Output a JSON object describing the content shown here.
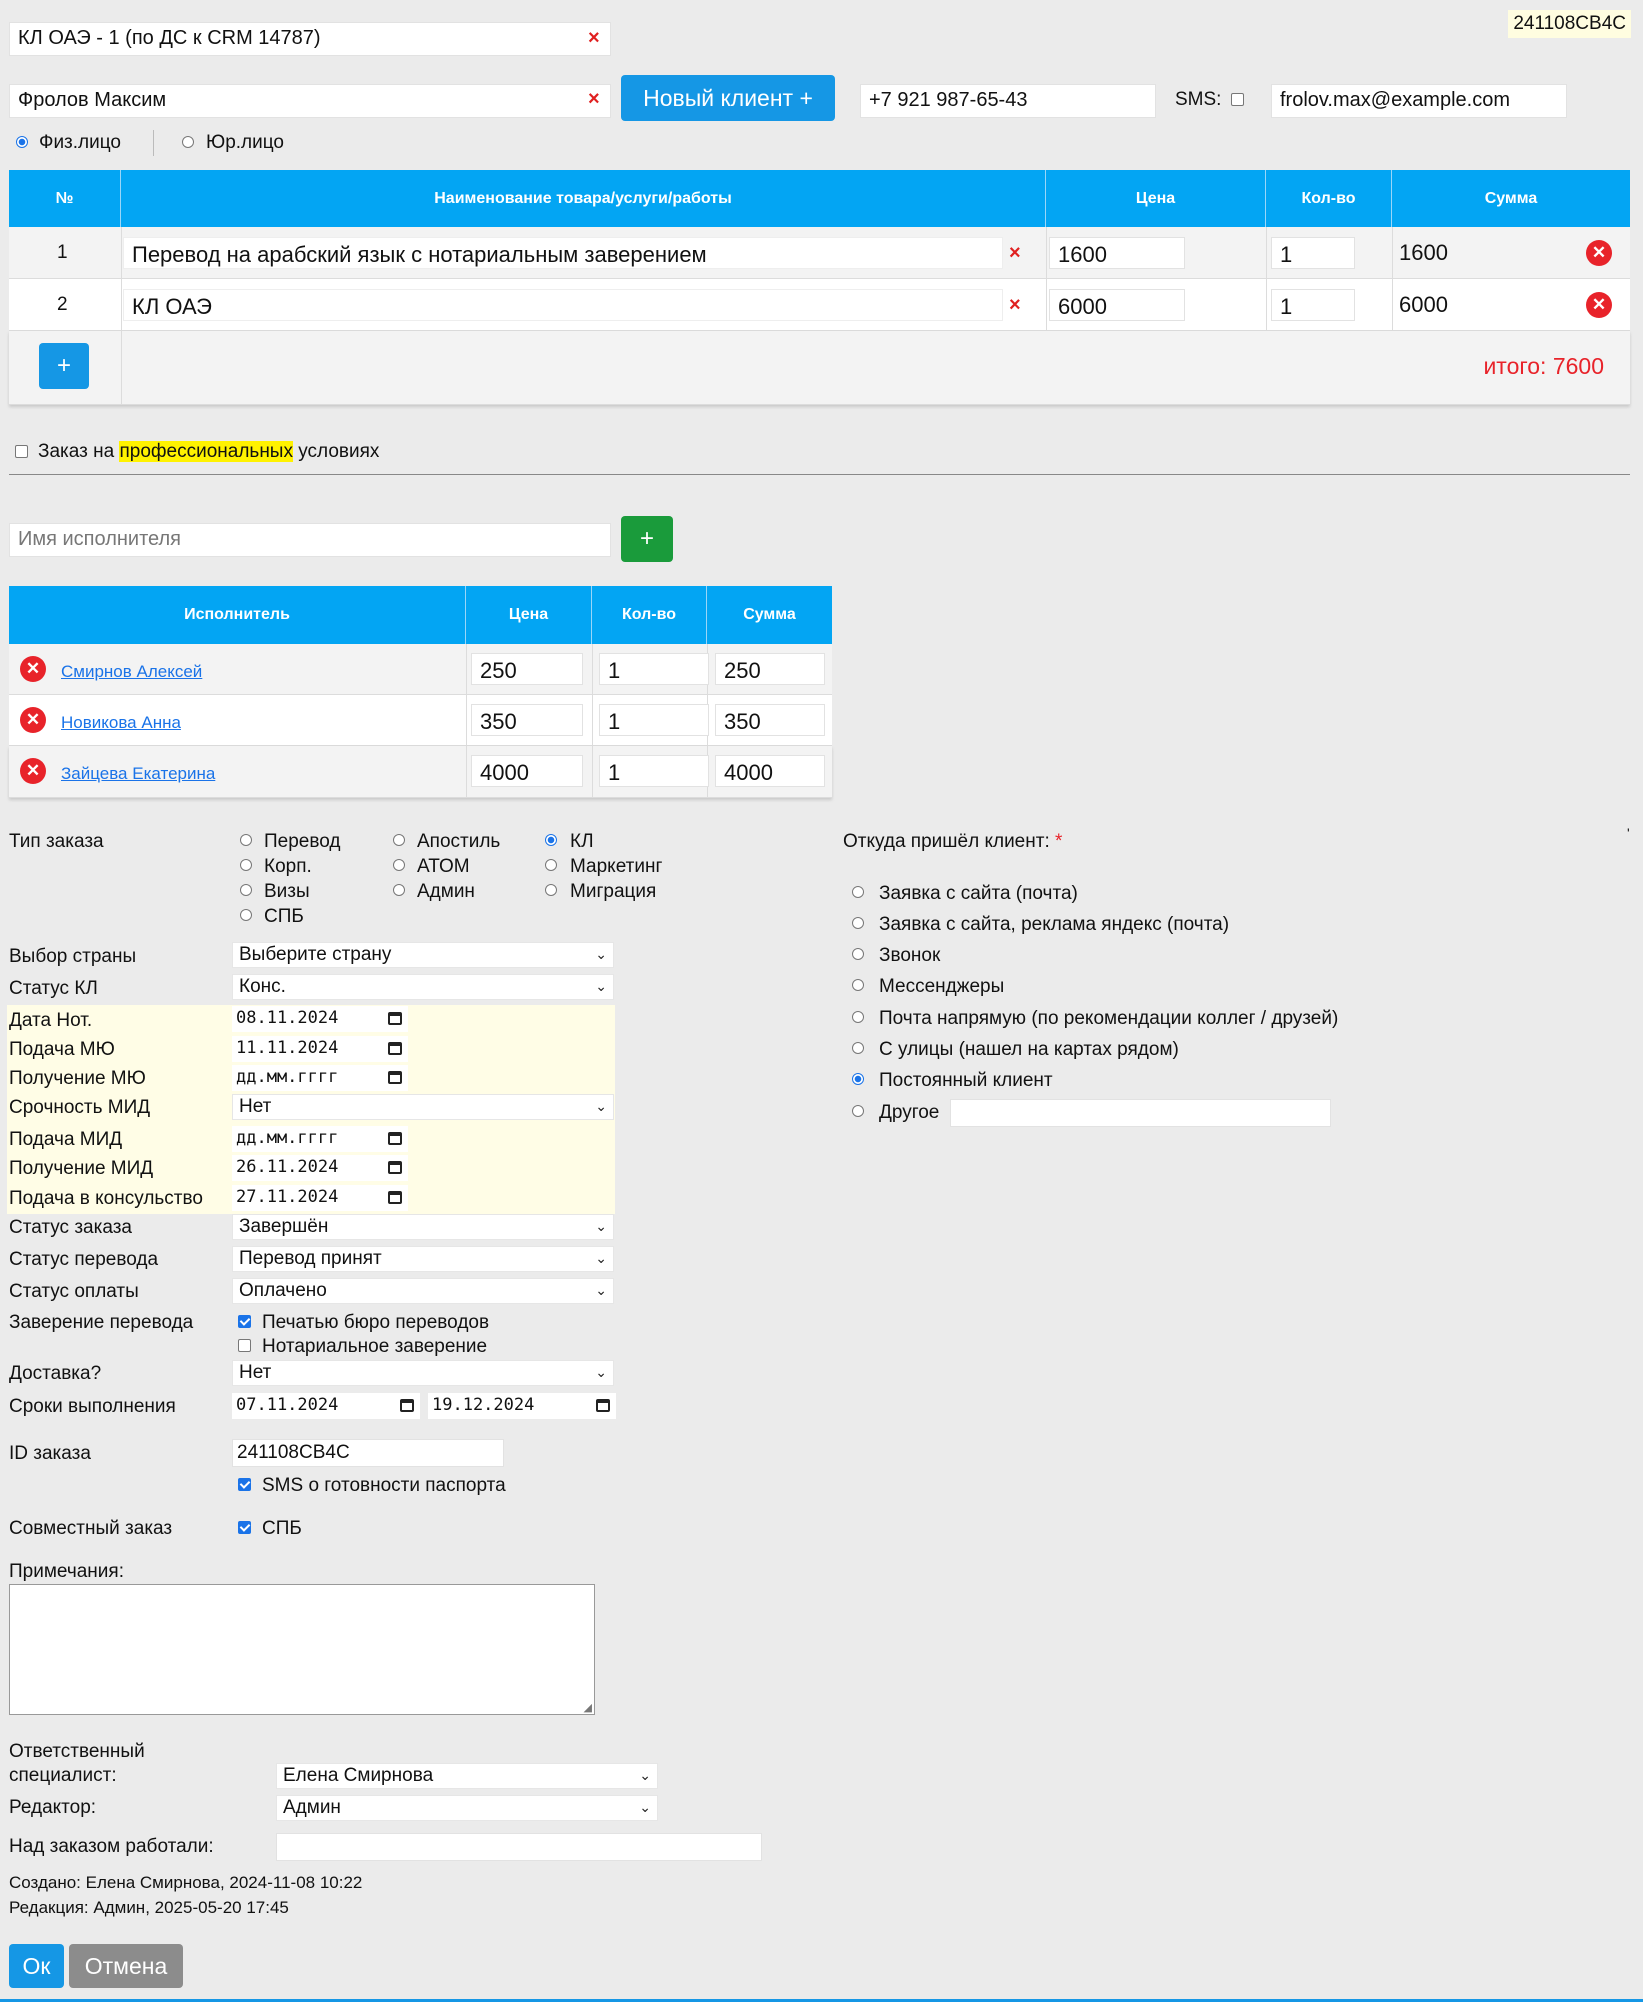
{
  "order_badge": "241108CB4C",
  "order_title": "КЛ ОАЭ - 1 (по ДС к CRM 14787)",
  "client": {
    "name": "Фролов Максим",
    "new_client_label": "Новый клиент +",
    "phone": "+7 921 987-65-43",
    "sms_label": "SMS:",
    "email": "frolov.max@example.com",
    "type_options": [
      "Физ.лицо",
      "Юр.лицо"
    ],
    "type_selected": "Физ.лицо"
  },
  "goods_table": {
    "headers": [
      "№",
      "Наименование товара/услуги/работы",
      "Цена",
      "Кол-во",
      "Сумма"
    ],
    "rows": [
      {
        "n": "1",
        "name": "Перевод на арабский язык с нотариальным заверением",
        "price": "1600",
        "qty": "1",
        "sum": "1600"
      },
      {
        "n": "2",
        "name": "КЛ ОАЭ",
        "price": "6000",
        "qty": "1",
        "sum": "6000"
      }
    ],
    "add_label": "+",
    "total_label": "итого: 7600"
  },
  "pro_terms": {
    "before": "Заказ на ",
    "highlight": "профессиональных",
    "after": " условиях"
  },
  "executor": {
    "placeholder": "Имя исполнителя",
    "add_label": "+",
    "headers": [
      "Исполнитель",
      "Цена",
      "Кол-во",
      "Сумма"
    ],
    "rows": [
      {
        "name": "Смирнов Алексей",
        "price": "250",
        "qty": "1",
        "sum": "250"
      },
      {
        "name": "Новикова Анна",
        "price": "350",
        "qty": "1",
        "sum": "350"
      },
      {
        "name": "Зайцева Екатерина",
        "price": "4000",
        "qty": "1",
        "sum": "4000"
      }
    ]
  },
  "order_type": {
    "label": "Тип заказа",
    "options": [
      "Перевод",
      "Апостиль",
      "КЛ",
      "Корп.",
      "АТОМ",
      "Маркетинг",
      "Визы",
      "Админ",
      "Миграция",
      "СПБ"
    ],
    "selected": "КЛ"
  },
  "source": {
    "label": "Откуда пришёл клиент:",
    "required_mark": "*",
    "stray_mark": "'",
    "options": [
      "Заявка с сайта (почта)",
      "Заявка с сайта, реклама яндекс (почта)",
      "Звонок",
      "Мессенджеры",
      "Почта напрямую (по рекомендации коллег / друзей)",
      "С улицы (нашел на картах рядом)",
      "Постоянный клиент",
      "Другое"
    ],
    "selected": "Постоянный клиент"
  },
  "fields": {
    "country_label": "Выбор страны",
    "country_value": "Выберите страну",
    "kl_status_label": "Статус КЛ",
    "kl_status_value": "Конс.",
    "not_date_label": "Дата Нот.",
    "not_date_value": "08.11.2024",
    "miu_submit_label": "Подача МЮ",
    "miu_submit_value": "11.11.2024",
    "miu_receive_label": "Получение МЮ",
    "miu_receive_value": "дд.мм.гггг",
    "mid_urgency_label": "Срочность МИД",
    "mid_urgency_value": "Нет",
    "mid_submit_label": "Подача МИД",
    "mid_submit_value": "дд.мм.гггг",
    "mid_receive_label": "Получение МИД",
    "mid_receive_value": "26.11.2024",
    "consulate_label": "Подача в консульство",
    "consulate_value": "27.11.2024",
    "order_status_label": "Статус заказа",
    "order_status_value": "Завершён",
    "translation_status_label": "Статус перевода",
    "translation_status_value": "Перевод принят",
    "payment_status_label": "Статус оплаты",
    "payment_status_value": "Оплачено",
    "certification_label": "Заверение перевода",
    "cert_stamp_label": "Печатью бюро переводов",
    "cert_notary_label": "Нотариальное заверение",
    "delivery_label": "Доставка?",
    "delivery_value": "Нет",
    "deadline_label": "Сроки выполнения",
    "deadline_from": "07.11.2024",
    "deadline_to": "19.12.2024",
    "order_id_label": "ID заказа",
    "order_id_value": "241108CB4C",
    "sms_ready_label": "SMS о готовности паспорта",
    "joint_label": "Совместный заказ",
    "joint_value_label": "СПБ",
    "notes_label": "Примечания:",
    "responsible_label_1": "Ответственный",
    "responsible_label_2": "специалист:",
    "responsible_value": "Елена Смирнова",
    "editor_label": "Редактор:",
    "editor_value": "Админ",
    "worked_label": "Над заказом работали:"
  },
  "meta": {
    "created": "Создано: Елена Смирнова, 2024-11-08 10:22",
    "edited": "Редакция: Админ, 2025-05-20 17:45"
  },
  "actions": {
    "ok": "Ок",
    "cancel": "Отмена"
  },
  "colors": {
    "accent": "#03a5f3",
    "button": "#1597e5",
    "danger": "#e8232a",
    "success": "#1a9b3b",
    "highlight": "#fff200"
  }
}
